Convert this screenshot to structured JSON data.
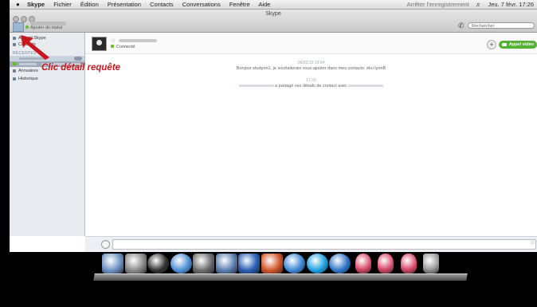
{
  "menubar": {
    "apple": "",
    "items": [
      "Skype",
      "Fichier",
      "Édition",
      "Présentation",
      "Contacts",
      "Conversations",
      "Fenêtre",
      "Aide"
    ],
    "recording": "Arrêter l'enregistrement",
    "clock": "Jeu. 7 févr. 17:26"
  },
  "window": {
    "title": "Skype"
  },
  "profile": {
    "status": "Ajouter du statut"
  },
  "search": {
    "placeholder": "Rechercher"
  },
  "sidebar": {
    "items": [
      {
        "label": "Accueil Skype",
        "icon": "home-icon"
      },
      {
        "label": "Contacts",
        "icon": "contacts-icon"
      }
    ],
    "recent_header": "RÉCENTES",
    "lower_items": [
      {
        "label": "Annuaires",
        "icon": "directory-icon"
      },
      {
        "label": "Historique",
        "icon": "history-icon"
      }
    ]
  },
  "chat": {
    "contact_status": "Connecté",
    "video_button": "Appel vidéo",
    "messages": [
      {
        "time": "06/02/13 19:04",
        "text": "Bonjour studyon1, je souhaiterais vous ajouter dans mes contacts. eku lyonB"
      },
      {
        "time": "17:26",
        "text": "a partagé ses détails de contact avec"
      }
    ]
  },
  "annotation": {
    "text": "Clic détail requête",
    "color": "#c8161d"
  },
  "dock": {
    "apps": [
      "finder-icon",
      "launchpad-icon",
      "dashboard-icon",
      "itunes-icon",
      "iphoto-icon",
      "preview-icon",
      "word-icon",
      "powerpoint-icon",
      "safari-icon",
      "skype-icon",
      "quicktime-icon",
      "doll-icon",
      "doll-icon",
      "doll-icon",
      "trash-icon"
    ]
  }
}
